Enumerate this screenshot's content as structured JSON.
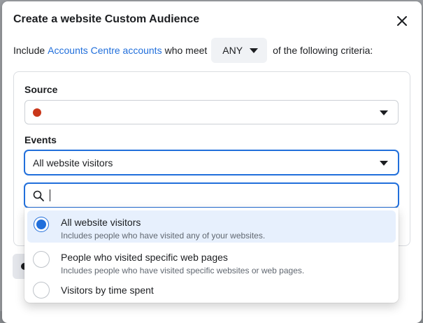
{
  "dialog": {
    "title": "Create a website Custom Audience",
    "close_icon": "close-icon"
  },
  "criteria": {
    "prefix": "Include",
    "link": "Accounts Centre accounts",
    "middle": "who meet",
    "match_value": "ANY",
    "suffix": "of the following criteria:"
  },
  "source": {
    "label": "Source",
    "status_color": "#c9371a",
    "value": ""
  },
  "events": {
    "label": "Events",
    "value": "All website visitors"
  },
  "search": {
    "value": "",
    "icon": "search-icon"
  },
  "options": [
    {
      "title": "All website visitors",
      "description": "Includes people who have visited any of your websites.",
      "selected": true
    },
    {
      "title": "People who visited specific web pages",
      "description": "Includes people who have visited specific websites or web pages.",
      "selected": false
    },
    {
      "title": "Visitors by time spent",
      "description": "",
      "selected": false
    }
  ],
  "colors": {
    "accent": "#216fdb",
    "selected_bg": "#e7f0fd",
    "text": "#1c1e21",
    "muted": "#606770"
  }
}
